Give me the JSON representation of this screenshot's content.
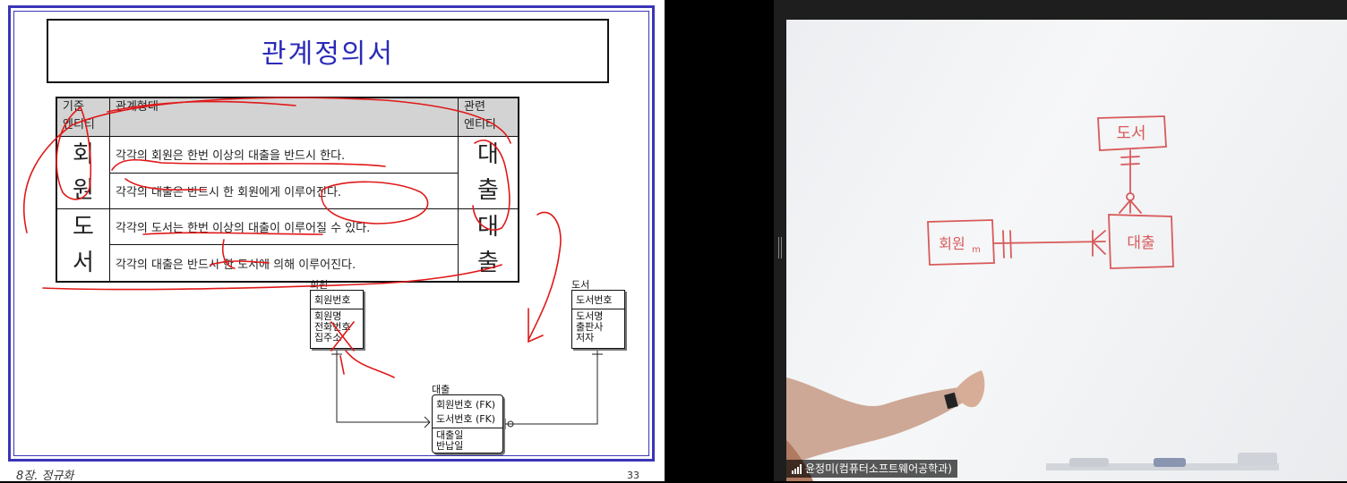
{
  "slide": {
    "title": "관계정의서",
    "table": {
      "headers": [
        "기준\n엔티티",
        "관계형태",
        "관련\n엔티티"
      ],
      "groups": [
        {
          "base": "회\n원",
          "related": "대\n출",
          "rows": [
            "각각의 회원은 한번 이상의 대출을 반드시 한다.",
            "각각의 대출은 반드시 한 회원에게 이루어진다."
          ]
        },
        {
          "base": "도\n서",
          "related": "대\n출",
          "rows": [
            "각각의 도서는 한번 이상의 대출이 이루어질 수 있다.",
            "각각의 대출은 반드시 한 도서에 의해 이루어진다."
          ]
        }
      ]
    },
    "erd": {
      "member": {
        "label": "회원",
        "pk": "회원번호",
        "attrs": [
          "회원명",
          "전화번호",
          "집주소"
        ]
      },
      "book": {
        "label": "도서",
        "pk": "도서번호",
        "attrs": [
          "도서명",
          "출판사",
          "저자"
        ]
      },
      "loan": {
        "label": "대출",
        "pk": [
          "회원번호 (FK)",
          "도서번호 (FK)"
        ],
        "attrs": [
          "대출일",
          "반납일"
        ]
      }
    },
    "footer_left": "8장. 정규화",
    "page_number": "33",
    "accent_color": "#3b35b8",
    "title_color": "#2a2ab8",
    "annotation_color": "#e01818"
  },
  "video": {
    "speaker_name": "윤정미(컴퓨터소프트웨어공학과)",
    "signal_icon": "signal-bars-icon",
    "whiteboard": {
      "entity_book": "도서",
      "entity_member": "회원",
      "entity_member_suffix": "m",
      "entity_loan": "대출"
    }
  }
}
